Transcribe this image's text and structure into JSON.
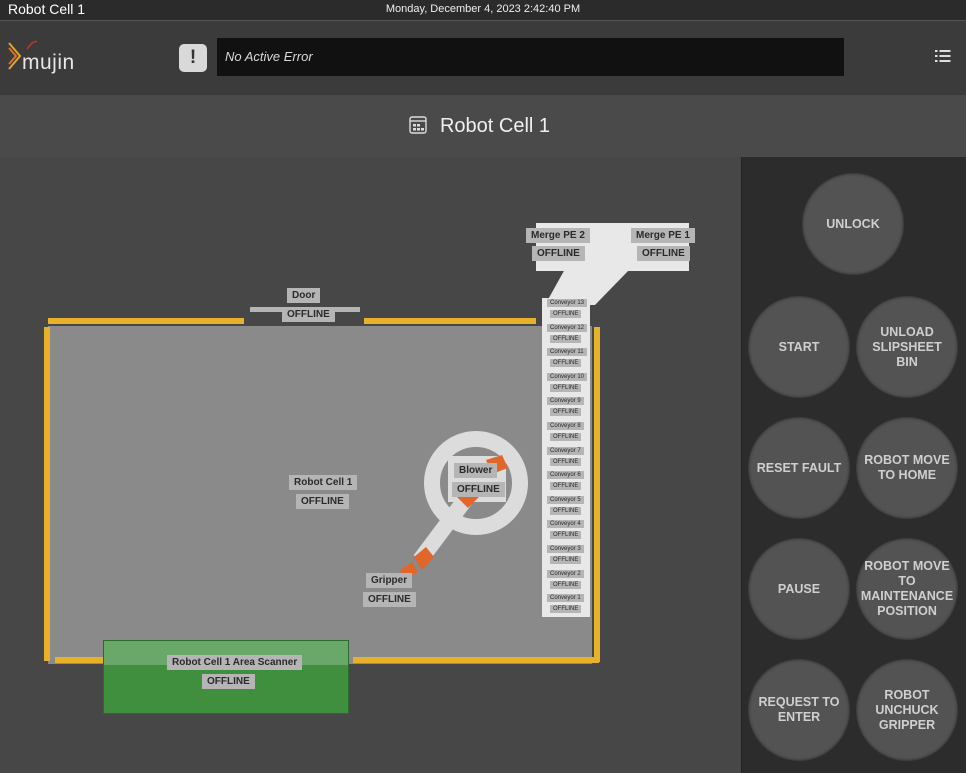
{
  "window": {
    "title": "Robot Cell 1",
    "datetime": "Monday, December 4, 2023 2:42:40 PM"
  },
  "brand": {
    "logo_text": "mujin"
  },
  "error_bar": {
    "icon": "exclamation-icon",
    "message": "No Active Error"
  },
  "header": {
    "title": "Robot Cell 1",
    "icon": "cell-layout-icon"
  },
  "map": {
    "cell": {
      "name": "Robot Cell 1",
      "status": "OFFLINE"
    },
    "door": {
      "name": "Door",
      "status": "OFFLINE"
    },
    "scanner": {
      "name": "Robot Cell 1 Area Scanner",
      "status": "OFFLINE"
    },
    "blower": {
      "name": "Blower",
      "status": "OFFLINE"
    },
    "gripper": {
      "name": "Gripper",
      "status": "OFFLINE"
    },
    "merge_pe2": {
      "name": "Merge PE 2",
      "status": "OFFLINE"
    },
    "merge_pe1": {
      "name": "Merge PE 1",
      "status": "OFFLINE"
    },
    "conveyors": [
      {
        "name": "Conveyor 13",
        "status": "OFFLINE"
      },
      {
        "name": "Conveyor 12",
        "status": "OFFLINE"
      },
      {
        "name": "Conveyor 11",
        "status": "OFFLINE"
      },
      {
        "name": "Conveyor 10",
        "status": "OFFLINE"
      },
      {
        "name": "Conveyor 9",
        "status": "OFFLINE"
      },
      {
        "name": "Conveyor 8",
        "status": "OFFLINE"
      },
      {
        "name": "Conveyor 7",
        "status": "OFFLINE"
      },
      {
        "name": "Conveyor 6",
        "status": "OFFLINE"
      },
      {
        "name": "Conveyor 5",
        "status": "OFFLINE"
      },
      {
        "name": "Conveyor 4",
        "status": "OFFLINE"
      },
      {
        "name": "Conveyor 3",
        "status": "OFFLINE"
      },
      {
        "name": "Conveyor 2",
        "status": "OFFLINE"
      },
      {
        "name": "Conveyor 1",
        "status": "OFFLINE"
      }
    ]
  },
  "controls": {
    "unlock": "UNLOCK",
    "start": "START",
    "unload_slipsheet_bin": "UNLOAD SLIPSHEET BIN",
    "reset_fault": "RESET FAULT",
    "robot_move_to_home": "ROBOT MOVE TO HOME",
    "pause": "PAUSE",
    "robot_move_to_maintenance": "ROBOT MOVE TO MAINTENANCE POSITION",
    "request_to_enter": "REQUEST TO ENTER",
    "robot_unchuck_gripper": "ROBOT UNCHUCK GRIPPER"
  },
  "colors": {
    "fence": "#e8b12a",
    "scanner_zone": "#3f8f3f",
    "robot": "#e0662a",
    "cell_floor": "#8a8a8a"
  }
}
